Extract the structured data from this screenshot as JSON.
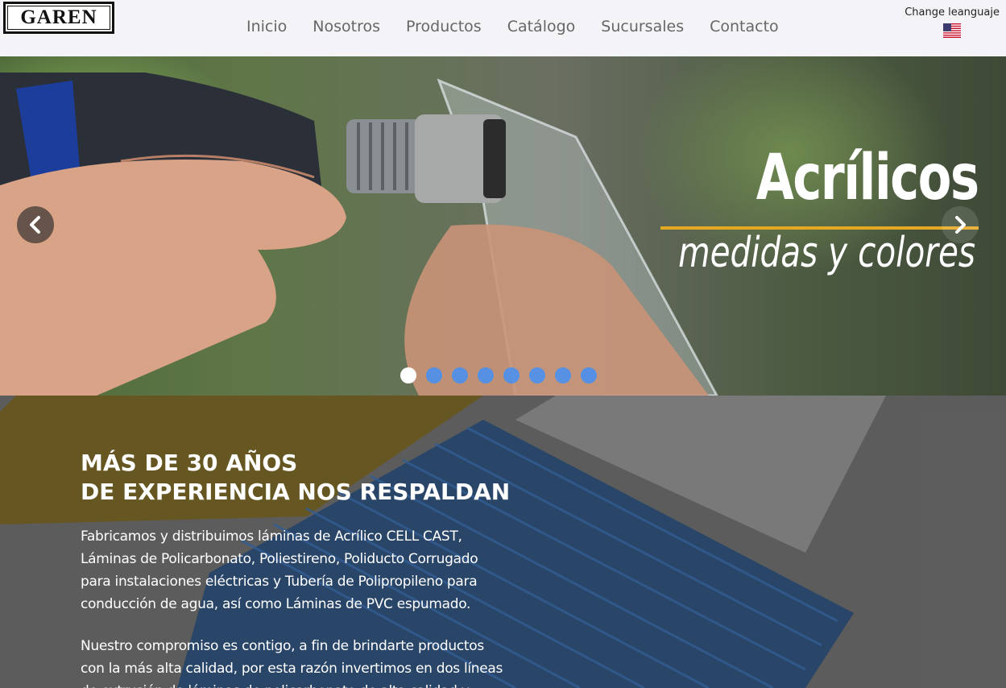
{
  "header": {
    "logo_text": "GAREN",
    "nav": [
      "Inicio",
      "Nosotros",
      "Productos",
      "Catálogo",
      "Sucursales",
      "Contacto"
    ],
    "language_label": "Change leanguaje",
    "language_icon": "us-flag-icon"
  },
  "hero": {
    "title": "Acrílicos",
    "subtitle": "medidas y colores",
    "accent_color": "#e5a823",
    "prev_icon": "chevron-left-icon",
    "next_icon": "chevron-right-icon",
    "slide_count": 8,
    "active_slide": 1
  },
  "about": {
    "title_line1": "MÁS DE 30 AÑOS",
    "title_line2": "DE EXPERIENCIA NOS RESPALDAN",
    "paragraph1": "Fabricamos y distribuimos láminas de Acrílico CELL CAST, Láminas de Policarbonato, Poliestireno, Poliducto Corrugado para instalaciones eléctricas y Tubería de Polipropileno para conducción de agua, así como Láminas de PVC espumado.",
    "paragraph2": "Nuestro compromiso es contigo, a fin de brindarte productos con la más alta calidad, por esta razón invertimos en dos líneas de extrusión de láminas de policarbonato de alta calidad y",
    "dot_color": "#4a90f0"
  }
}
